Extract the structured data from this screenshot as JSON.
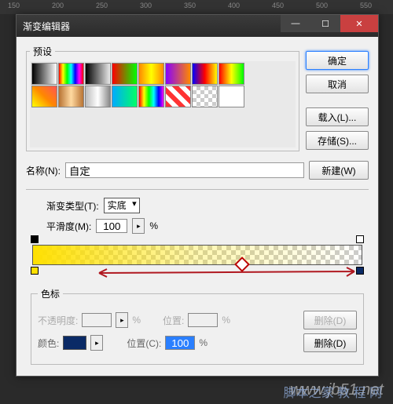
{
  "ruler": [
    "150",
    "200",
    "250",
    "300",
    "350",
    "400",
    "450",
    "500",
    "550"
  ],
  "window": {
    "title": "渐变编辑器"
  },
  "presets": {
    "legend": "预设"
  },
  "buttons": {
    "ok": "确定",
    "cancel": "取消",
    "load": "载入(L)...",
    "save": "存储(S)...",
    "new": "新建(W)",
    "deleteOp": "删除(D)",
    "deleteCol": "删除(D)"
  },
  "name": {
    "label": "名称(N):",
    "value": "自定"
  },
  "gradType": {
    "label": "渐变类型(T):",
    "value": "实底"
  },
  "smooth": {
    "label": "平滑度(M):",
    "value": "100",
    "suffix": "%"
  },
  "stops": {
    "legend": "色标",
    "opacity": {
      "label": "不透明度:",
      "value": "",
      "suffix": "%",
      "posLabel": "位置:",
      "posValue": ""
    },
    "color": {
      "label": "颜色:",
      "value": "#0a2a66",
      "posLabel": "位置(C):",
      "posValue": "100",
      "suffix": "%"
    }
  },
  "swatches": [
    "linear-gradient(90deg,#000,#fff)",
    "linear-gradient(90deg,#f00,#ff0,#0f0,#0ff,#00f,#f0f,#f00)",
    "linear-gradient(90deg,#000,transparent)",
    "linear-gradient(90deg,#f00,#0f0)",
    "linear-gradient(90deg,#f80,#ff0,#f80)",
    "linear-gradient(90deg,#80f,#f80)",
    "linear-gradient(90deg,#00f,#f00,#ff0)",
    "linear-gradient(90deg,#f00,#ff0,#0f0)",
    "linear-gradient(45deg,#ff0,#f80,#f55)",
    "linear-gradient(90deg,#b87333,#ffd9a0,#b87333)",
    "linear-gradient(90deg,#bbb,#fff,#888)",
    "linear-gradient(90deg,#0af,#0f6)",
    "linear-gradient(90deg,#f00,#ff0,#0f0,#0ff,#00f,#f0f)",
    "repeating-linear-gradient(45deg,#f33 0 6px,#fff 6px 12px)",
    "repeating-conic-gradient(#ccc 0 25%,#fff 0 50%)",
    "#fff"
  ],
  "chart_data": {
    "type": "gradient",
    "stops": [
      {
        "position": 0,
        "color": "#ffe000",
        "opacity": 1
      },
      {
        "position": 100,
        "color": "#0a2a66",
        "opacity": 0
      }
    ],
    "midpoint": 62
  },
  "watermark": "www.jb51.net",
  "watermark2": "脚本之家 教 程 网"
}
